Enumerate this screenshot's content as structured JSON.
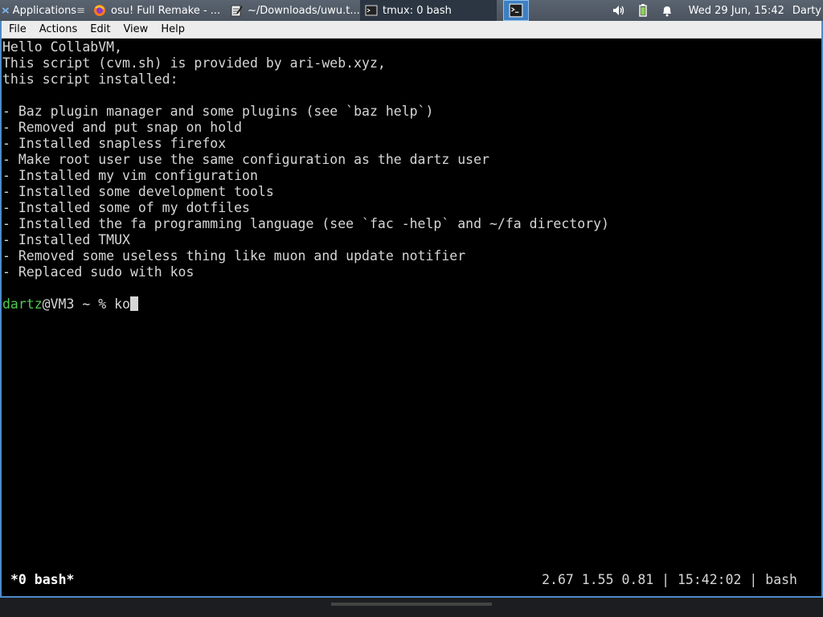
{
  "panel": {
    "applications_label": "Applications",
    "tasks": [
      {
        "label": "osu! Full Remake - ...",
        "icon": "firefox-icon"
      },
      {
        "label": "~/Downloads/uwu.t...",
        "icon": "text-editor-icon"
      },
      {
        "label": "tmux: 0 bash",
        "icon": "terminal-icon"
      }
    ],
    "clock": "Wed 29 Jun, 15:42",
    "user": "Darty"
  },
  "menubar": {
    "file": "File",
    "actions": "Actions",
    "edit": "Edit",
    "view": "View",
    "help": "Help"
  },
  "terminal": {
    "lines": [
      "Hello CollabVM,",
      "This script (cvm.sh) is provided by ari-web.xyz,",
      "this script installed:",
      "",
      "- Baz plugin manager and some plugins (see `baz help`)",
      "- Removed and put snap on hold",
      "- Installed snapless firefox",
      "- Make root user use the same configuration as the dartz user",
      "- Installed my vim configuration",
      "- Installed some development tools",
      "- Installed some of my dotfiles",
      "- Installed the fa programming language (see `fac -help` and ~/fa directory)",
      "- Installed TMUX",
      "- Removed some useless thing like muon and update notifier",
      "- Replaced sudo with kos",
      ""
    ],
    "prompt_user": "dartz",
    "prompt_rest": "@VM3 ~ % ",
    "input": "ko"
  },
  "tmux_status": {
    "window": "*0 bash*",
    "right": "2.67 1.55 0.81 | 15:42:02 | bash"
  },
  "colors": {
    "prompt_user": "#4fc94f",
    "window_border": "#4d8ac9",
    "terminal_fg": "#d6d6d6"
  }
}
